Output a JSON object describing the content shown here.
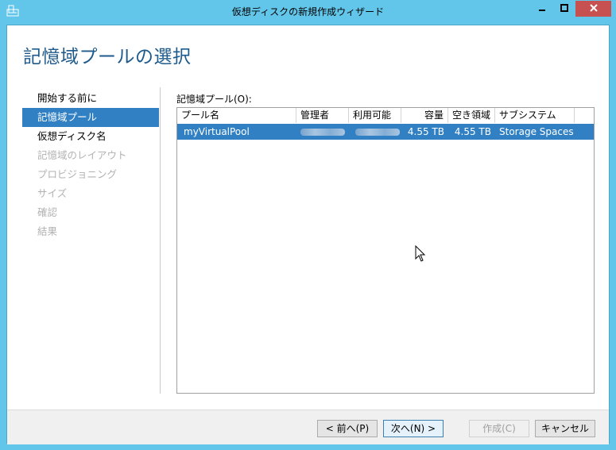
{
  "window": {
    "title": "仮想ディスクの新規作成ウィザード",
    "controls": {
      "minimize": "minimize",
      "maximize": "maximize",
      "close": "close"
    }
  },
  "page": {
    "title": "記憶域プールの選択"
  },
  "nav": {
    "items": [
      {
        "label": "開始する前に",
        "state": "normal"
      },
      {
        "label": "記憶域プール",
        "state": "selected"
      },
      {
        "label": "仮想ディスク名",
        "state": "normal"
      },
      {
        "label": "記憶域のレイアウト",
        "state": "disabled"
      },
      {
        "label": "プロビジョニング",
        "state": "disabled"
      },
      {
        "label": "サイズ",
        "state": "disabled"
      },
      {
        "label": "確認",
        "state": "disabled"
      },
      {
        "label": "結果",
        "state": "disabled"
      }
    ]
  },
  "pool_list": {
    "label": "記憶域プール(O):",
    "columns": [
      "プール名",
      "管理者",
      "利用可能",
      "容量",
      "空き領域",
      "サブシステム"
    ],
    "rows": [
      {
        "name": "myVirtualPool",
        "admin": "",
        "available": "",
        "capacity": "4.55 TB",
        "free": "4.55 TB",
        "subsystem": "Storage Spaces",
        "selected": true
      }
    ]
  },
  "footer": {
    "prev_label": "< 前へ(P)",
    "next_label": "次へ(N) >",
    "create_label": "作成(C)",
    "cancel_label": "キャンセル"
  },
  "colors": {
    "frame": "#62c6ea",
    "title_accent": "#1e5a8c",
    "selection": "#3180c3",
    "close_button": "#c75050"
  }
}
